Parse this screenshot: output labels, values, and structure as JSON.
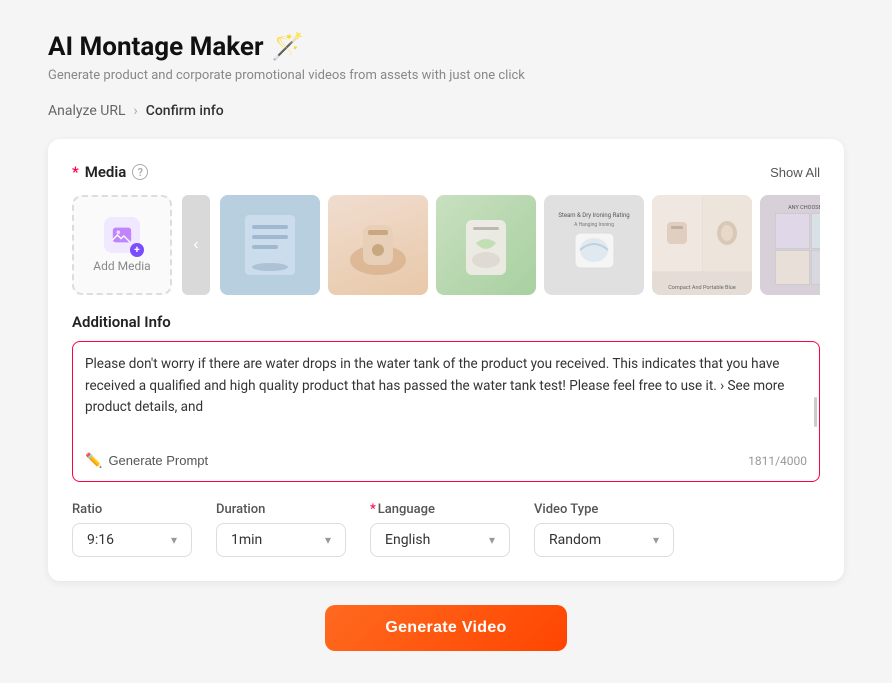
{
  "page": {
    "title": "AI Montage Maker",
    "title_emoji": "🪄",
    "subtitle": "Generate product and corporate promotional videos from assets with just one click"
  },
  "breadcrumb": {
    "step1": "Analyze URL",
    "step2": "Confirm info"
  },
  "media_section": {
    "label": "Media",
    "show_all_label": "Show All",
    "add_media_label": "Add Media",
    "info_icon_label": "?"
  },
  "additional_info": {
    "label": "Additional Info",
    "text": "Please don't worry if there are water drops in the water tank of the product you received. This indicates that you have received a qualified and high quality product that has passed the water tank test! Please feel free to use it. › See more product details, and",
    "char_count": "1811/4000",
    "generate_prompt_label": "Generate Prompt"
  },
  "options": {
    "ratio": {
      "label": "Ratio",
      "value": "9:16"
    },
    "duration": {
      "label": "Duration",
      "value": "1min"
    },
    "language": {
      "label": "Language",
      "value": "English",
      "required": true
    },
    "video_type": {
      "label": "Video Type",
      "value": "Random"
    }
  },
  "generate_button": {
    "label": "Generate Video"
  }
}
